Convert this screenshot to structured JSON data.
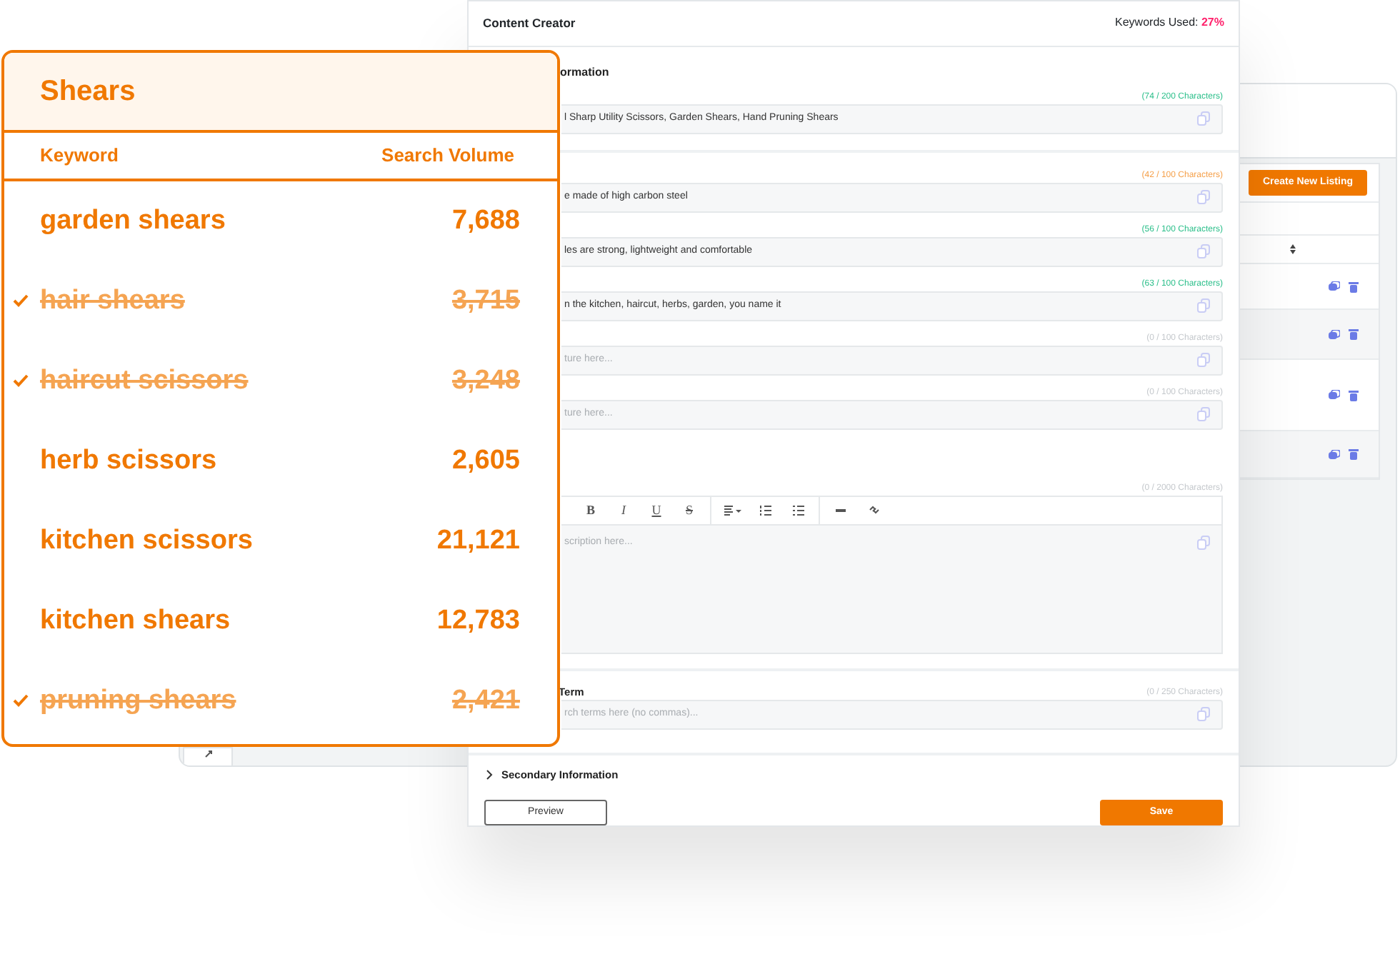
{
  "keyword_card": {
    "title": "Shears",
    "columns": [
      "Keyword",
      "Search Volume"
    ],
    "rows": [
      {
        "keyword": "garden shears",
        "volume": "7,688",
        "used": false
      },
      {
        "keyword": "hair shears",
        "volume": "3,715",
        "used": true
      },
      {
        "keyword": "haircut scissors",
        "volume": "3,248",
        "used": true
      },
      {
        "keyword": "herb scissors",
        "volume": "2,605",
        "used": false
      },
      {
        "keyword": "kitchen scissors",
        "volume": "21,121",
        "used": false
      },
      {
        "keyword": "kitchen shears",
        "volume": "12,783",
        "used": false
      },
      {
        "keyword": "pruning shears",
        "volume": "2,421",
        "used": true
      }
    ]
  },
  "content_creator": {
    "title": "Content Creator",
    "keywords_used_label": "Keywords Used:",
    "keywords_used_value": "27%",
    "sections": [
      {
        "heading": "ormation",
        "fields": [
          {
            "kind": "text",
            "counter": "(74 / 200 Characters)",
            "color": "#2bbf8a",
            "value": "l Sharp Utility Scissors, Garden Shears, Hand Pruning Shears"
          }
        ]
      },
      {
        "fields": [
          {
            "kind": "text",
            "counter": "(42 / 100 Characters)",
            "color": "#f5a04a",
            "value": "e made of high carbon steel"
          },
          {
            "kind": "text",
            "counter": "(56 / 100 Characters)",
            "color": "#2bbf8a",
            "value": "les are strong, lightweight and comfortable"
          },
          {
            "kind": "text",
            "counter": "(63 / 100 Characters)",
            "color": "#2bbf8a",
            "value": "n the kitchen, haircut, herbs, garden, you name it"
          },
          {
            "kind": "text",
            "counter": "(0 / 100 Characters)",
            "color": "#c4c8cc",
            "placeholder": "ture here..."
          },
          {
            "kind": "text",
            "counter": "(0 / 100 Characters)",
            "color": "#c4c8cc",
            "placeholder": "ture here..."
          },
          {
            "kind": "editor",
            "counter": "(0 / 2000 Characters)",
            "color": "#c4c8cc",
            "placeholder": "scription here...",
            "toolbar": [
              {
                "kind": "bold",
                "label": "B"
              },
              {
                "kind": "italic",
                "label": "I"
              },
              {
                "kind": "underline",
                "label": "U"
              },
              {
                "kind": "strike",
                "label": "S"
              },
              {
                "kind": "align"
              },
              {
                "kind": "ordered-list"
              },
              {
                "kind": "bullet-list"
              },
              {
                "kind": "rule"
              },
              {
                "kind": "link"
              }
            ]
          }
        ]
      },
      {
        "fields": [
          {
            "kind": "text",
            "label": "Term",
            "counter": "(0 / 250 Characters)",
            "color": "#c4c8cc",
            "placeholder": "rch terms here (no commas)..."
          }
        ]
      }
    ],
    "secondary_section": {
      "label": "Secondary Information",
      "expanded": false
    },
    "buttons": [
      {
        "kind": "outline",
        "label": "Preview"
      },
      {
        "kind": "primary",
        "label": "Save"
      }
    ]
  },
  "listings_window": {
    "create_button": "Create New Listing"
  }
}
